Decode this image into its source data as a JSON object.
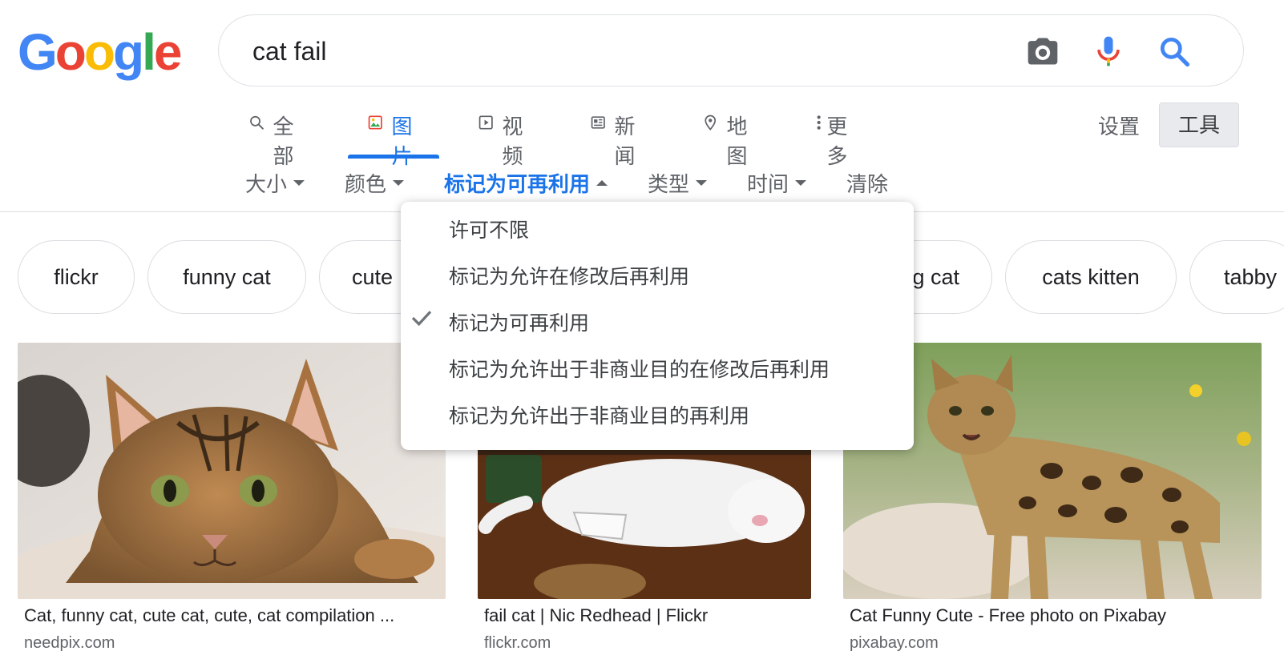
{
  "logo": {
    "letters": [
      "G",
      "o",
      "o",
      "g",
      "l",
      "e"
    ],
    "colors": [
      "#4285F4",
      "#EA4335",
      "#FBBC05",
      "#4285F4",
      "#34A853",
      "#EA4335"
    ]
  },
  "search": {
    "query": "cat fail"
  },
  "tabs": [
    {
      "label": "全部",
      "icon": "search-icon"
    },
    {
      "label": "图片",
      "icon": "image-icon",
      "active": true
    },
    {
      "label": "视频",
      "icon": "video-icon"
    },
    {
      "label": "新闻",
      "icon": "news-icon"
    },
    {
      "label": "地图",
      "icon": "map-pin-icon"
    },
    {
      "label": "更多",
      "icon": "more-vert-icon"
    }
  ],
  "settings_label": "设置",
  "tools_label": "工具",
  "filters": [
    {
      "label": "大小"
    },
    {
      "label": "颜色"
    },
    {
      "label": "标记为可再利用",
      "active": true
    },
    {
      "label": "类型"
    },
    {
      "label": "时间"
    },
    {
      "label": "清除"
    }
  ],
  "chips": [
    "flickr",
    "funny cat",
    "cute",
    "g cat",
    "cats kitten",
    "tabby"
  ],
  "results": [
    {
      "title": "Cat, funny cat, cute cat, cute, cat compilation ...",
      "source": "needpix.com"
    },
    {
      "title": "fail cat | Nic Redhead | Flickr",
      "source": "flickr.com"
    },
    {
      "title": "Cat Funny Cute - Free photo on Pixabay",
      "source": "pixabay.com"
    }
  ],
  "dropdown": {
    "items": [
      {
        "label": "许可不限",
        "checked": false
      },
      {
        "label": "标记为允许在修改后再利用",
        "checked": false
      },
      {
        "label": "标记为可再利用",
        "checked": true
      },
      {
        "label": "标记为允许出于非商业目的在修改后再利用",
        "checked": false
      },
      {
        "label": "标记为允许出于非商业目的再利用",
        "checked": false
      }
    ]
  },
  "colors": {
    "accent": "#1a73e8",
    "text_secondary": "#5f6368"
  }
}
